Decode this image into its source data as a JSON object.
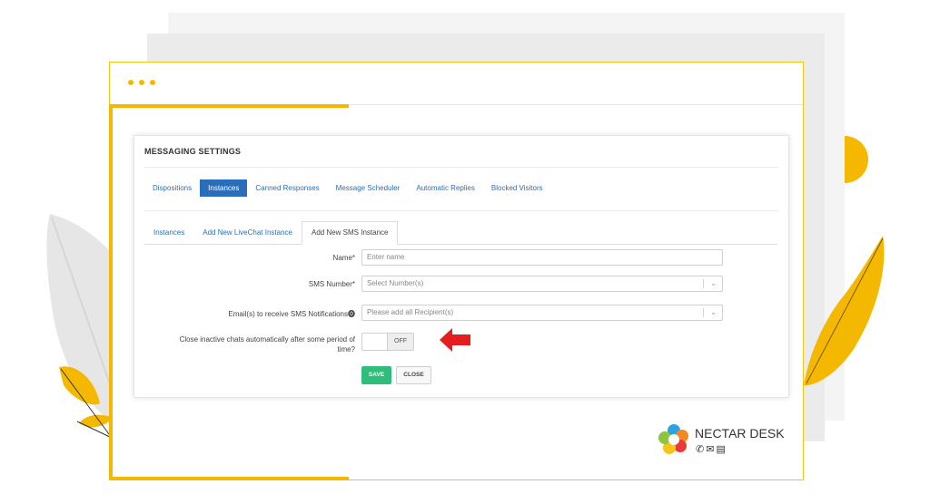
{
  "panel": {
    "title": "MESSAGING SETTINGS"
  },
  "tabs": [
    {
      "label": "Dispositions"
    },
    {
      "label": "Instances"
    },
    {
      "label": "Canned Responses"
    },
    {
      "label": "Message Scheduler"
    },
    {
      "label": "Automatic Replies"
    },
    {
      "label": "Blocked Visitors"
    }
  ],
  "active_tab": "Instances",
  "subtabs": [
    {
      "label": "Instances"
    },
    {
      "label": "Add New LiveChat Instance"
    },
    {
      "label": "Add New SMS Instance"
    }
  ],
  "active_subtab": "Add New SMS Instance",
  "form": {
    "name": {
      "label": "Name*",
      "placeholder": "Enter name"
    },
    "sms_number": {
      "label": "SMS Number*",
      "placeholder": "Select Number(s)"
    },
    "emails": {
      "label": "Email(s) to receive SMS Notifications⓿",
      "placeholder": "Please add all Recipient(s)"
    },
    "close_inactive": {
      "label_line1": "Close inactive chats automatically after some period of",
      "label_line2": "time?",
      "state": "OFF"
    },
    "save_label": "SAVE",
    "close_label": "CLOSE"
  },
  "brand": {
    "name": "NECTAR DESK",
    "icons": [
      "phone-icon",
      "mail-icon",
      "chat-icon"
    ]
  },
  "colors": {
    "accent_yellow": "#f5b800",
    "link_blue": "#2a6ebb",
    "save_green": "#2ebd7b",
    "arrow_red": "#e41e1e"
  }
}
